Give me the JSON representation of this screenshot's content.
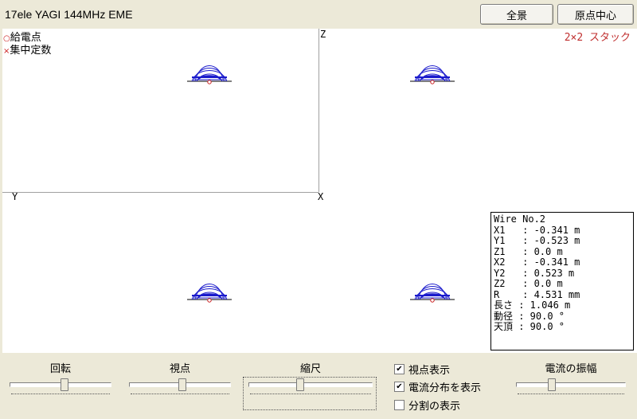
{
  "window": {
    "title": "17ele YAGI 144MHz EME"
  },
  "toolbar": {
    "overview_label": "全景",
    "origin_center_label": "原点中心"
  },
  "legend": {
    "feed_point": "給電点",
    "lumped_constant": "集中定数",
    "feed_marker": "○",
    "lumped_marker": "×"
  },
  "stack_label": "2×2 スタック",
  "axes": {
    "z": "Z",
    "y": "Y",
    "x": "X"
  },
  "wire_info": {
    "title": "Wire No.2",
    "rows": [
      "X1   : -0.341 m",
      "Y1   : -0.523 m",
      "Z1   : 0.0 m",
      "X2   : -0.341 m",
      "Y2   : 0.523 m",
      "Z2   : 0.0 m",
      "R    : 4.531 mm",
      "長さ : 1.046 m",
      "動径 : 90.0 °",
      "天頂 : 90.0 °"
    ]
  },
  "controls": {
    "rotation": "回転",
    "viewpoint": "視点",
    "scale": "縮尺",
    "current_amplitude": "電流の振幅",
    "show_viewpoint": {
      "label": "視点表示",
      "checked": true
    },
    "show_current": {
      "label": "電流分布を表示",
      "checked": true
    },
    "show_segments": {
      "label": "分割の表示",
      "checked": false
    }
  },
  "colors": {
    "pattern": "#1a1acc",
    "feed": "#cc2020",
    "accent": "#c03030"
  }
}
